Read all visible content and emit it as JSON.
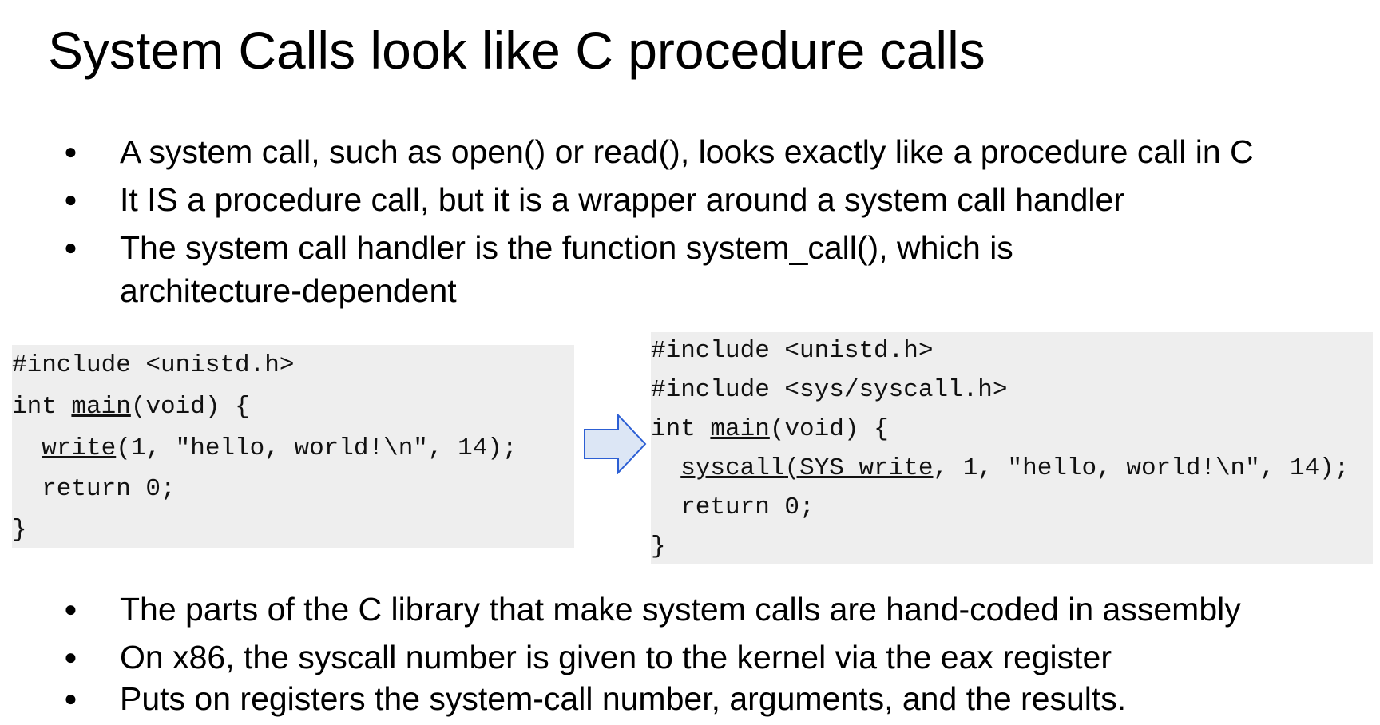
{
  "slide": {
    "title": "System Calls look like C procedure calls",
    "bullets_top": [
      "A system call, such as open() or read(), looks exactly like a procedure call in C",
      "It IS a procedure call, but it is a wrapper around a system call handler",
      "The system call handler is the function system_call(), which is",
      "architecture-dependent"
    ],
    "bullets_bottom": [
      "The parts of the C library that make system calls are hand-coded in assembly",
      "On x86, the syscall number is given to the kernel via the eax register",
      "Puts on registers the system-call number, arguments, and the results."
    ],
    "bullet_symbol": "●"
  },
  "code_left": {
    "line1": "#include <unistd.h>",
    "line2_pre": "int ",
    "line2_fn": "main",
    "line2_post": "(void) {",
    "line3_indent": "  ",
    "line3_fn": "write",
    "line3_post": "(1, \"hello, world!\\n\", 14);",
    "line4": "  return 0;",
    "line5": "}"
  },
  "code_right": {
    "line1": "#include <unistd.h>",
    "line2": "#include <sys/syscall.h>",
    "line3_pre": "int ",
    "line3_fn": "main",
    "line3_post": "(void) {",
    "line4_indent": "  ",
    "line4_fn": "syscall",
    "line4_paren": "(",
    "line4_arg": "SYS_write",
    "line4_post": ", 1, \"hello, world!\\n\", 14);",
    "line5": "  return 0;",
    "line6": "}"
  },
  "colors": {
    "code_background": "#eeeeee",
    "arrow_fill": "#dce6f5",
    "arrow_stroke": "#2c5fd4"
  },
  "icons": {
    "arrow": "right-arrow-icon"
  }
}
